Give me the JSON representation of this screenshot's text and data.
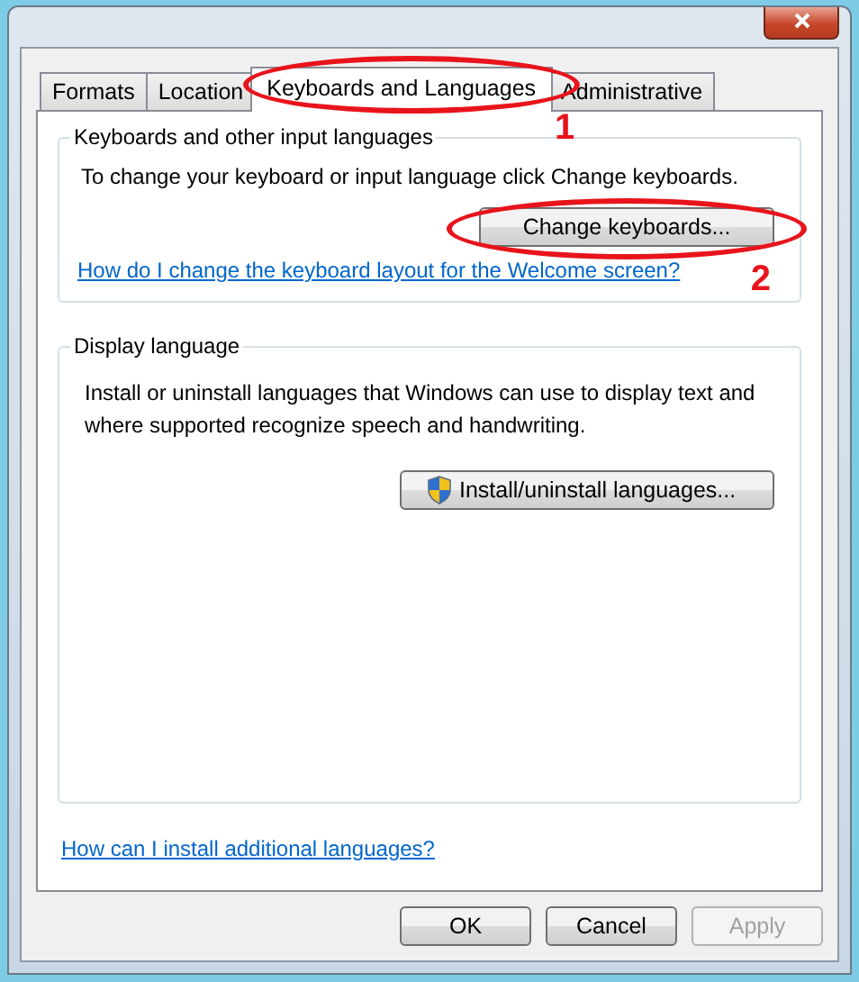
{
  "tabs": [
    {
      "label": "Formats",
      "selected": false
    },
    {
      "label": "Location",
      "selected": false
    },
    {
      "label": "Keyboards and Languages",
      "selected": true
    },
    {
      "label": "Administrative",
      "selected": false
    }
  ],
  "keyboards_group": {
    "title": "Keyboards and other input languages",
    "description": "To change your keyboard or input language click Change keyboards.",
    "button": "Change keyboards...",
    "link": "How do I change the keyboard layout for the Welcome screen?"
  },
  "display_language_group": {
    "title": "Display language",
    "description": "Install or uninstall languages that Windows can use to display text and where supported recognize speech and handwriting.",
    "button": "Install/uninstall languages..."
  },
  "link": "How can I install additional languages?",
  "buttons": [
    {
      "label": "OK",
      "disabled": false
    },
    {
      "label": "Cancel",
      "disabled": false
    },
    {
      "label": "Apply",
      "disabled": true
    }
  ],
  "annotations": [
    {
      "label": "1"
    },
    {
      "label": "2"
    }
  ]
}
